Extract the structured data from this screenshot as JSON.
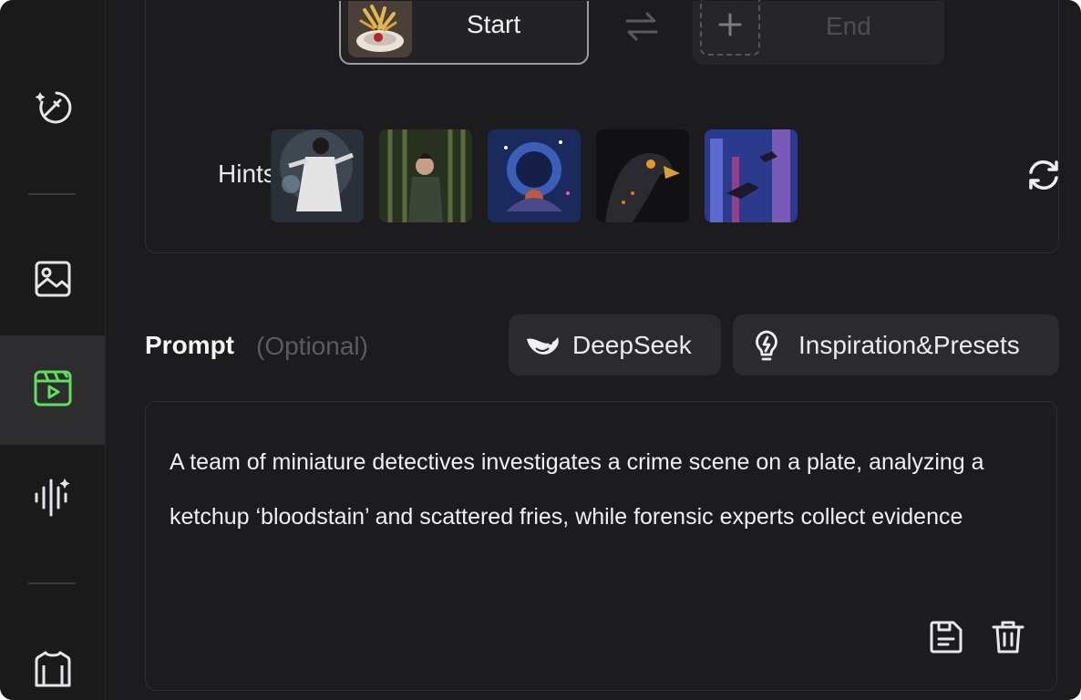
{
  "sidebar": {
    "items": [
      {
        "name": "magic-edit-icon"
      },
      {
        "name": "image-icon"
      },
      {
        "name": "video-icon",
        "active": true
      },
      {
        "name": "audio-sparkle-icon"
      },
      {
        "name": "shirt-icon"
      }
    ],
    "active_color": "#5ee05a"
  },
  "frames": {
    "start_label": "Start",
    "end_label": "End",
    "swap_icon": "swap-arrows-icon",
    "add_icon": "plus-icon"
  },
  "hints": {
    "label": "Hints",
    "thumbnails": [
      "warrior-in-white-robe",
      "figure-in-bamboo-forest",
      "astronaut-in-space",
      "eagle-portrait",
      "figures-flying-in-neon-city"
    ],
    "refresh_icon": "refresh-icon"
  },
  "prompt": {
    "title": "Prompt",
    "optional": "(Optional)",
    "deepseek_label": "DeepSeek",
    "inspiration_label": "Inspiration&Presets",
    "text": "A team of miniature detectives investigates a crime scene on a plate, analyzing a ketchup ‘bloodstain’ and scattered fries, while forensic experts collect evidence"
  }
}
